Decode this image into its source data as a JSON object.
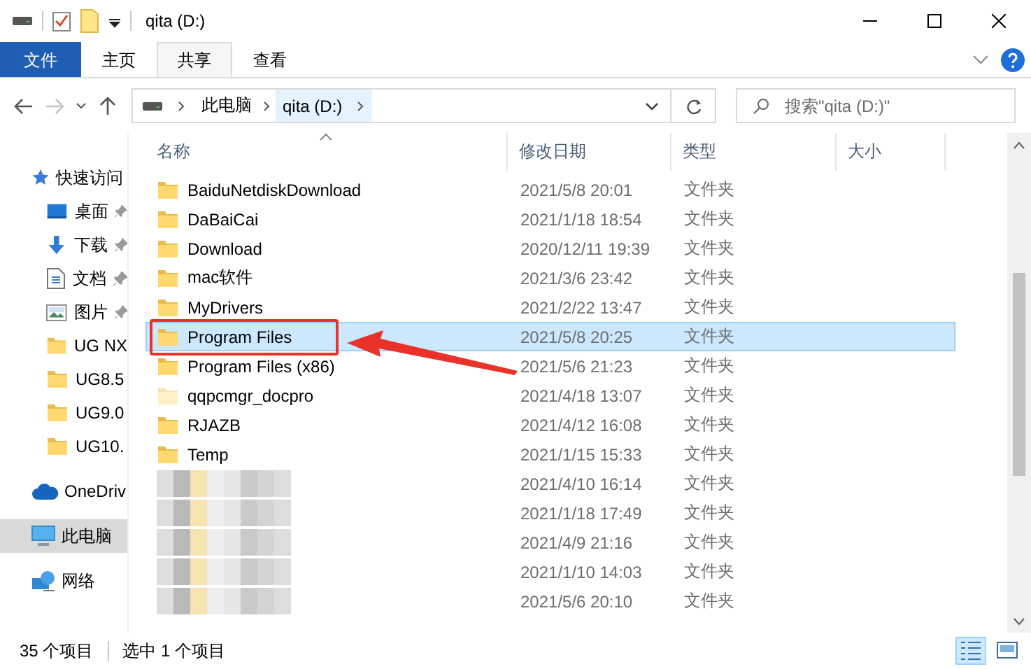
{
  "window": {
    "title": "qita (D:)"
  },
  "ribbon_tabs": [
    {
      "label": "文件",
      "kind": "file",
      "selected": false
    },
    {
      "label": "主页",
      "kind": "tab",
      "selected": false
    },
    {
      "label": "共享",
      "kind": "tab",
      "selected": true
    },
    {
      "label": "查看",
      "kind": "tab",
      "selected": false
    }
  ],
  "nav_buttons": [
    {
      "kind": "back",
      "disabled": false
    },
    {
      "kind": "forward",
      "disabled": true
    },
    {
      "kind": "recent",
      "disabled": false
    },
    {
      "kind": "up",
      "disabled": false
    }
  ],
  "address": {
    "crumbs": [
      "此电脑",
      "qita (D:)"
    ]
  },
  "search": {
    "placeholder": "搜索\"qita (D:)\""
  },
  "sidebar": {
    "items": [
      {
        "label": "快速访问",
        "kind": "star",
        "selected": false,
        "children": [
          {
            "label": "桌面",
            "kind": "desktop",
            "pinned": true,
            "selected": false
          },
          {
            "label": "下载",
            "kind": "download",
            "pinned": true,
            "selected": false
          },
          {
            "label": "文档",
            "kind": "document",
            "pinned": true,
            "selected": false
          },
          {
            "label": "图片",
            "kind": "image",
            "pinned": true,
            "selected": false
          },
          {
            "label": "UG NX",
            "kind": "folder",
            "pinned": false,
            "selected": false
          },
          {
            "label": "UG8.5",
            "kind": "folder",
            "pinned": false,
            "selected": false
          },
          {
            "label": "UG9.0",
            "kind": "folder",
            "pinned": false,
            "selected": false
          },
          {
            "label": "UG10.",
            "kind": "folder",
            "pinned": false,
            "selected": false
          }
        ]
      },
      {
        "label": "OneDriv",
        "kind": "cloud",
        "selected": false
      },
      {
        "label": "此电脑",
        "kind": "computer",
        "selected": true
      },
      {
        "label": "网络",
        "kind": "network",
        "selected": false
      }
    ]
  },
  "table": {
    "columns": [
      {
        "label": "名称",
        "sorted": true
      },
      {
        "label": "修改日期",
        "sorted": false
      },
      {
        "label": "类型",
        "sorted": false
      },
      {
        "label": "大小",
        "sorted": false
      }
    ],
    "rows": [
      {
        "name": "BaiduNetdiskDownload",
        "date": "2021/5/8 20:01",
        "type": "文件夹",
        "selected": false,
        "hidden": false,
        "marked": false,
        "redacted": false
      },
      {
        "name": "DaBaiCai",
        "date": "2021/1/18 18:54",
        "type": "文件夹",
        "selected": false,
        "hidden": false,
        "marked": false,
        "redacted": false
      },
      {
        "name": "Download",
        "date": "2020/12/11 19:39",
        "type": "文件夹",
        "selected": false,
        "hidden": false,
        "marked": false,
        "redacted": false
      },
      {
        "name": "mac软件",
        "date": "2021/3/6 23:42",
        "type": "文件夹",
        "selected": false,
        "hidden": false,
        "marked": false,
        "redacted": false
      },
      {
        "name": "MyDrivers",
        "date": "2021/2/22 13:47",
        "type": "文件夹",
        "selected": false,
        "hidden": false,
        "marked": false,
        "redacted": false
      },
      {
        "name": "Program Files",
        "date": "2021/5/8 20:25",
        "type": "文件夹",
        "selected": true,
        "hidden": false,
        "marked": true,
        "redacted": false
      },
      {
        "name": "Program Files (x86)",
        "date": "2021/5/6 21:23",
        "type": "文件夹",
        "selected": false,
        "hidden": false,
        "marked": false,
        "redacted": false
      },
      {
        "name": "qqpcmgr_docpro",
        "date": "2021/4/18 13:07",
        "type": "文件夹",
        "selected": false,
        "hidden": true,
        "marked": false,
        "redacted": false
      },
      {
        "name": "RJAZB",
        "date": "2021/4/12 16:08",
        "type": "文件夹",
        "selected": false,
        "hidden": false,
        "marked": false,
        "redacted": false
      },
      {
        "name": "Temp",
        "date": "2021/1/15 15:33",
        "type": "文件夹",
        "selected": false,
        "hidden": false,
        "marked": false,
        "redacted": false
      },
      {
        "date": "2021/4/10 16:14",
        "type": "文件夹",
        "selected": false,
        "hidden": false,
        "marked": false,
        "redacted": true
      },
      {
        "date": "2021/1/18 17:49",
        "type": "文件夹",
        "selected": false,
        "hidden": false,
        "marked": false,
        "redacted": true
      },
      {
        "date": "2021/4/9 21:16",
        "type": "文件夹",
        "selected": false,
        "hidden": false,
        "marked": false,
        "redacted": true
      },
      {
        "date": "2021/1/10 14:03",
        "type": "文件夹",
        "selected": false,
        "hidden": false,
        "marked": false,
        "redacted": true
      },
      {
        "date": "2021/5/6 20:10",
        "type": "文件夹",
        "selected": false,
        "hidden": false,
        "marked": false,
        "redacted": true
      }
    ]
  },
  "status_bar": {
    "count": "35 个项目",
    "selection": "选中 1 个项目",
    "views": [
      {
        "kind": "details",
        "selected": true
      },
      {
        "kind": "tiles",
        "selected": false
      }
    ]
  }
}
